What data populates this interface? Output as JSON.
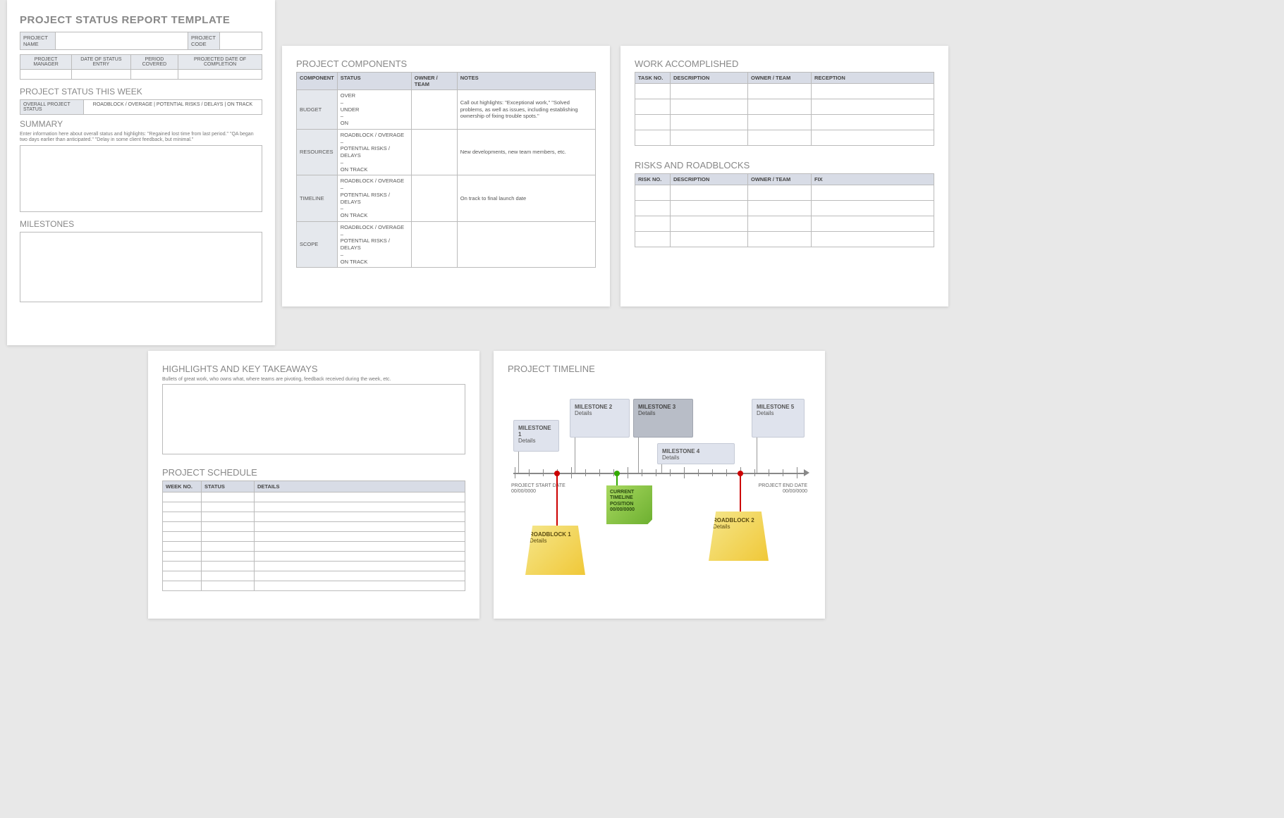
{
  "page1": {
    "title": "PROJECT STATUS REPORT TEMPLATE",
    "project_name_label": "PROJECT NAME",
    "project_code_label": "PROJECT CODE",
    "header_cols": [
      "PROJECT MANAGER",
      "DATE OF STATUS ENTRY",
      "PERIOD COVERED",
      "PROJECTED DATE OF COMPLETION"
    ],
    "status_week_title": "PROJECT STATUS THIS WEEK",
    "overall_label": "OVERALL PROJECT STATUS",
    "status_options": "ROADBLOCK / OVERAGE   |   POTENTIAL RISKS / DELAYS   |   ON TRACK",
    "summary_title": "SUMMARY",
    "summary_hint": "Enter information here about overall status and highlights: \"Regained lost time from last period.\" \"QA began two days earlier than anticipated.\" \"Delay in some client feedback, but minimal.\"",
    "milestones_title": "MILESTONES"
  },
  "page2": {
    "title": "PROJECT COMPONENTS",
    "cols": [
      "COMPONENT",
      "STATUS",
      "OWNER / TEAM",
      "NOTES"
    ],
    "rows": [
      {
        "comp": "BUDGET",
        "status": "OVER\n–\nUNDER\n–\nON",
        "notes": "Call out highlights: \"Exceptional work,\" \"Solved problems, as well as issues, including establishing ownership of fixing trouble spots.\""
      },
      {
        "comp": "RESOURCES",
        "status": "ROADBLOCK / OVERAGE\n–\nPOTENTIAL RISKS / DELAYS\n–\nON TRACK",
        "notes": "New developments, new team members, etc."
      },
      {
        "comp": "TIMELINE",
        "status": "ROADBLOCK / OVERAGE\n–\nPOTENTIAL RISKS / DELAYS\n–\nON TRACK",
        "notes": "On track to final launch date"
      },
      {
        "comp": "SCOPE",
        "status": "ROADBLOCK / OVERAGE\n–\nPOTENTIAL RISKS / DELAYS\n–\nON TRACK",
        "notes": ""
      }
    ]
  },
  "page3": {
    "work_title": "WORK ACCOMPLISHED",
    "work_cols": [
      "TASK NO.",
      "DESCRIPTION",
      "OWNER / TEAM",
      "RECEPTION"
    ],
    "risks_title": "RISKS AND ROADBLOCKS",
    "risks_cols": [
      "RISK NO.",
      "DESCRIPTION",
      "OWNER / TEAM",
      "FIX"
    ]
  },
  "page4": {
    "highlights_title": "HIGHLIGHTS AND KEY TAKEAWAYS",
    "highlights_hint": "Bullets of great work, who owns what, where teams are pivoting, feedback received during the week, etc.",
    "schedule_title": "PROJECT SCHEDULE",
    "schedule_cols": [
      "WEEK NO.",
      "STATUS",
      "DETAILS"
    ]
  },
  "page5": {
    "title": "PROJECT TIMELINE",
    "milestones": [
      {
        "name": "MILESTONE 1",
        "sub": "Details"
      },
      {
        "name": "MILESTONE 2",
        "sub": "Details"
      },
      {
        "name": "MILESTONE 3",
        "sub": "Details"
      },
      {
        "name": "MILESTONE 4",
        "sub": "Details"
      },
      {
        "name": "MILESTONE 5",
        "sub": "Details"
      }
    ],
    "start_label": "PROJECT START DATE",
    "start_date": "00/00/0000",
    "end_label": "PROJECT END DATE",
    "end_date": "00/00/0000",
    "roadblocks": [
      {
        "name": "ROADBLOCK 1",
        "sub": "Details"
      },
      {
        "name": "ROADBLOCK 2",
        "sub": "Details"
      }
    ],
    "current": {
      "l1": "CURRENT",
      "l2": "TIMELINE",
      "l3": "POSITION",
      "date": "00/00/0000"
    }
  }
}
